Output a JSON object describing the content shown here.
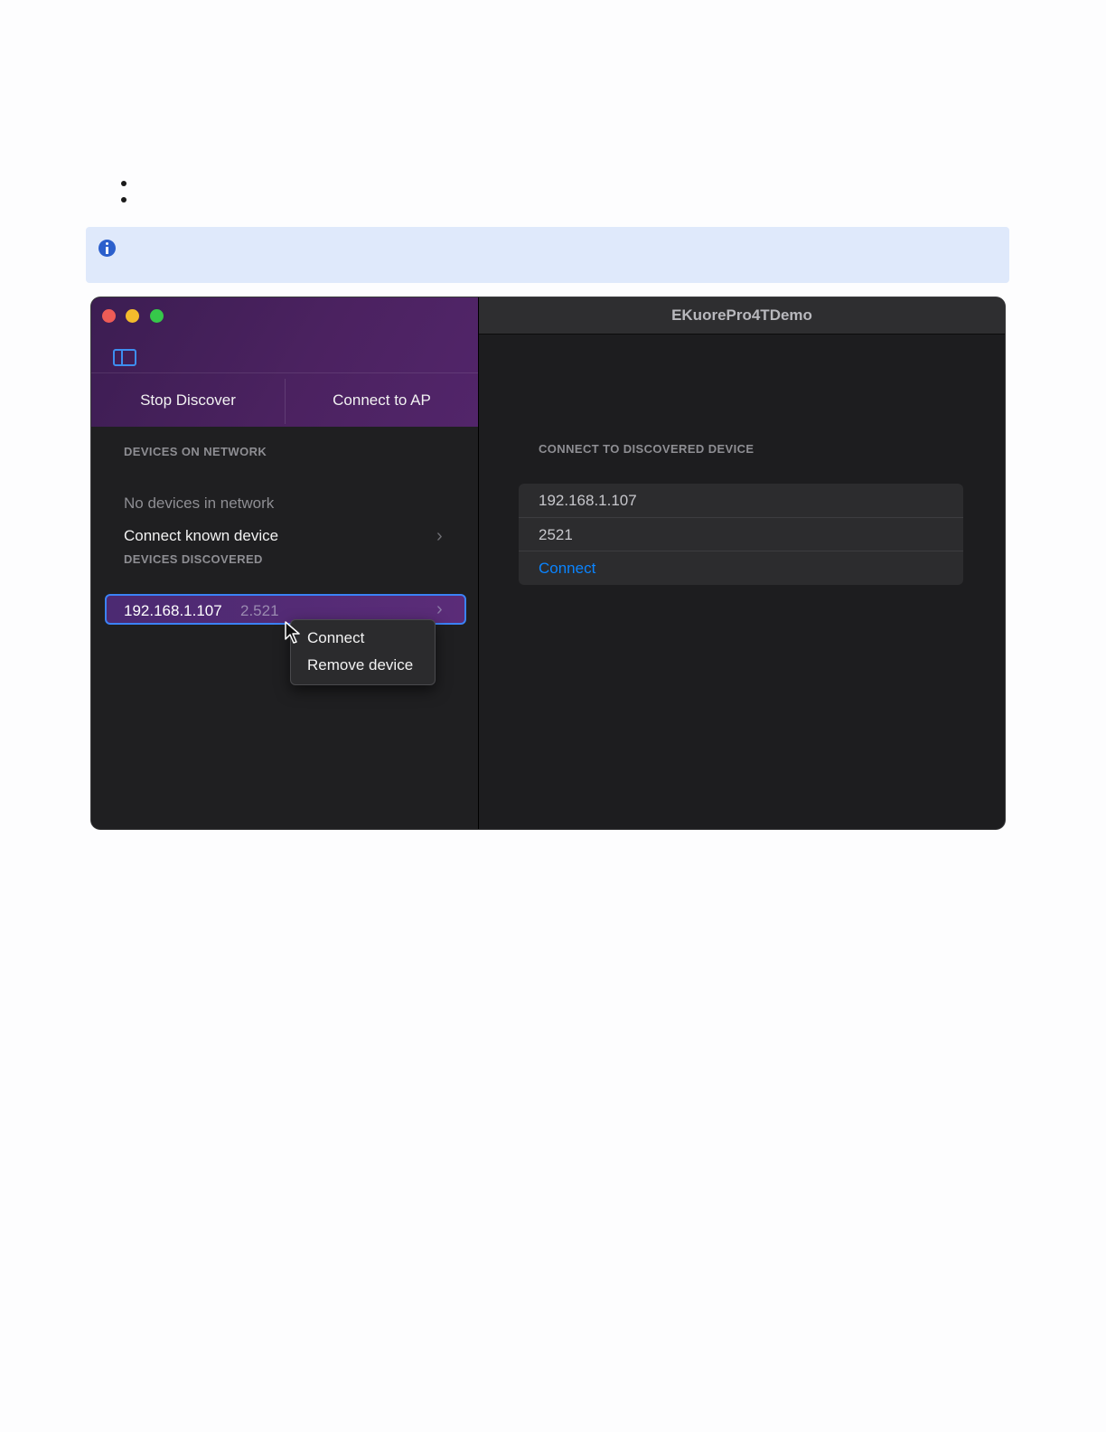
{
  "window": {
    "title": "EKuorePro4TDemo"
  },
  "sidebar": {
    "segmented": {
      "stop_discover": "Stop Discover",
      "connect_to_ap": "Connect to AP"
    },
    "devices_on_network": {
      "header": "DEVICES ON NETWORK",
      "empty_text": "No devices in network",
      "connect_known": "Connect known device"
    },
    "devices_discovered": {
      "header": "DEVICES DISCOVERED",
      "items": [
        {
          "ip": "192.168.1.107",
          "port": "2.521"
        }
      ]
    },
    "context_menu": {
      "items": [
        "Connect",
        "Remove device"
      ]
    }
  },
  "main": {
    "section_header": "CONNECT TO DISCOVERED DEVICE",
    "ip_value": "192.168.1.107",
    "port_value": "2521",
    "connect_label": "Connect"
  },
  "colors": {
    "accent": "#0a84ff",
    "sidebar_gradient": "#4b2260",
    "selection_border": "#3b82f6",
    "info_box": "#dfe9fb"
  }
}
